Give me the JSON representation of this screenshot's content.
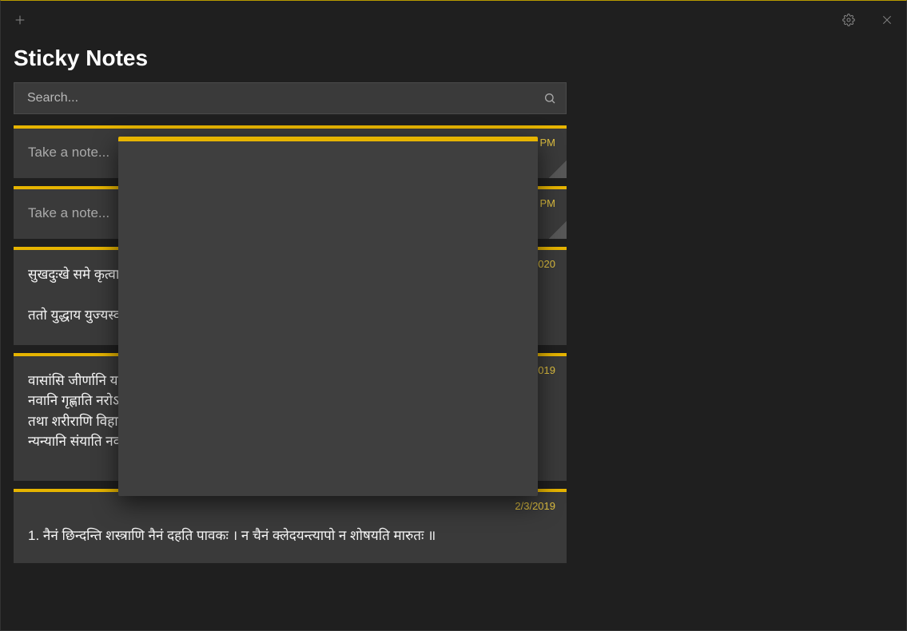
{
  "header": {
    "app_title": "Sticky Notes"
  },
  "search": {
    "placeholder": "Search..."
  },
  "notes": [
    {
      "timestamp": "3:55 PM",
      "placeholder": "Take a note...",
      "body": "",
      "fold": true
    },
    {
      "timestamp": "3:54 PM",
      "placeholder": "Take a note...",
      "body": "",
      "fold": true
    },
    {
      "timestamp": "3/25/2020",
      "placeholder": "",
      "body": "सुखदुःखे समे कृत्वा लाभालाभौ जयाजयौ ।\n\nततो युद्धाय युज्यस्व नैवं पापमवाप्स्यसि ॥",
      "fold": false
    },
    {
      "timestamp": "2/3/2019",
      "placeholder": "",
      "body": "वासांसि जीर्णानि यथा विहाय\nनवानि गृह्णाति नरोऽपराणि ।\nतथा शरीराणि विहाय जीर्णा-\nन्यन्यानि संयाति नवानि देही ॥",
      "fold": false
    },
    {
      "timestamp": "2/3/2019",
      "placeholder": "",
      "body": "1. नैनं छिन्दन्ति शस्त्राणि नैनं दहति पावकः । न चैनं क्लेदयन्त्यापो न शोषयति मारुतः ॥",
      "fold": false
    }
  ],
  "icons": {
    "add": "add-icon",
    "settings": "gear-icon",
    "close": "close-icon",
    "search": "search-icon"
  },
  "colors": {
    "accent": "#e6b400",
    "card_bg": "#3a3a3a",
    "window_bg": "#1f1f1f"
  }
}
